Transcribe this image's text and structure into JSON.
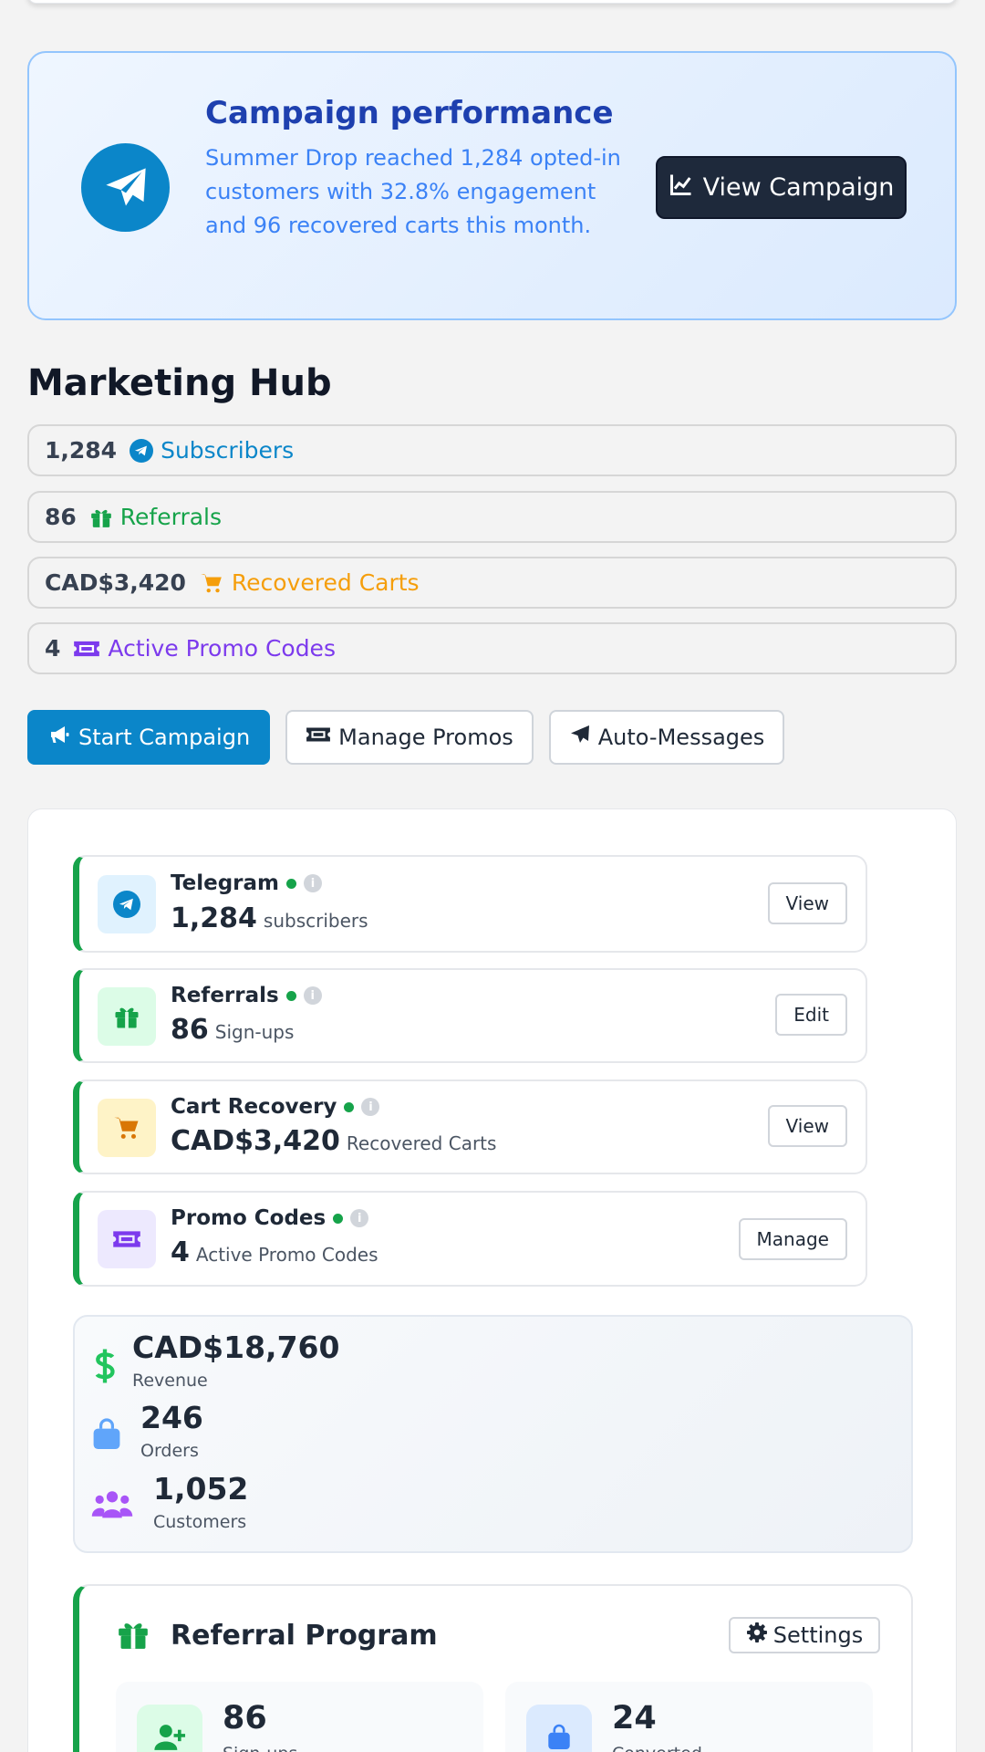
{
  "campaign": {
    "title": "Campaign performance",
    "description": "Summer Drop reached 1,284 opted-in customers with 32.8% engagement and 96 recovered carts this month.",
    "button_label": "View Campaign",
    "icon": "paper-plane-icon",
    "accent": "#0b86c9"
  },
  "hub": {
    "title": "Marketing Hub",
    "stats": [
      {
        "value": "1,284",
        "label": "Subscribers",
        "icon": "telegram-icon",
        "color": "#0b86c9"
      },
      {
        "value": "86",
        "label": "Referrals",
        "icon": "gift-icon",
        "color": "#16a34a"
      },
      {
        "value": "CAD$3,420",
        "label": "Recovered Carts",
        "icon": "cart-icon",
        "color": "#f59e0b"
      },
      {
        "value": "4",
        "label": "Active Promo Codes",
        "icon": "ticket-icon",
        "color": "#7c3aed"
      }
    ]
  },
  "actions": {
    "start_campaign": "Start Campaign",
    "manage_promos": "Manage Promos",
    "auto_messages": "Auto-Messages"
  },
  "channels": [
    {
      "name": "Telegram",
      "value": "1,284",
      "unit": "subscribers",
      "button": "View",
      "icon": "telegram-icon"
    },
    {
      "name": "Referrals",
      "value": "86",
      "unit": "Sign-ups",
      "button": "Edit",
      "icon": "gift-icon"
    },
    {
      "name": "Cart Recovery",
      "value": "CAD$3,420",
      "unit": "Recovered Carts",
      "button": "View",
      "icon": "cart-icon"
    },
    {
      "name": "Promo Codes",
      "value": "4",
      "unit": "Active Promo Codes",
      "button": "Manage",
      "icon": "ticket-icon"
    }
  ],
  "metrics": [
    {
      "value": "CAD$18,760",
      "label": "Revenue",
      "icon": "dollar-icon"
    },
    {
      "value": "246",
      "label": "Orders",
      "icon": "shopping-bag-icon"
    },
    {
      "value": "1,052",
      "label": "Customers",
      "icon": "users-icon"
    }
  ],
  "referral": {
    "title": "Referral Program",
    "settings_label": "Settings",
    "boxes": [
      {
        "value": "86",
        "label": "Sign-ups",
        "icon": "user-plus-icon"
      },
      {
        "value": "24",
        "label": "Converted",
        "icon": "shopping-bag-icon"
      }
    ]
  }
}
